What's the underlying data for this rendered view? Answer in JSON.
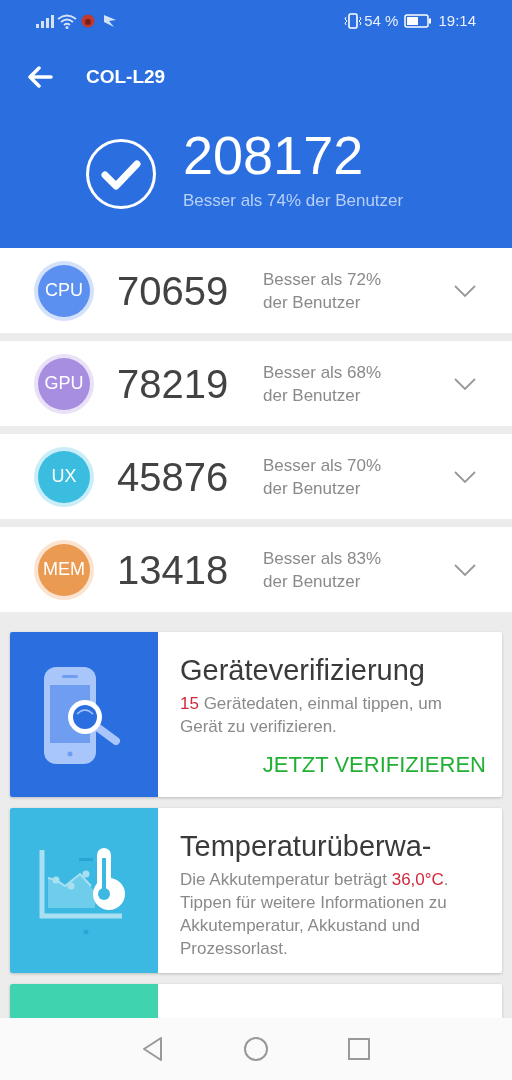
{
  "status_bar": {
    "battery_text": "54 %",
    "time": "19:14"
  },
  "header": {
    "title": "COL-L29",
    "total_score": "208172",
    "total_caption": "Besser als 74% der Benutzer"
  },
  "scores": [
    {
      "label": "CPU",
      "color": "#5b8ff0",
      "score": "70659",
      "caption": "Besser als 72% der Benutzer",
      "expanded": false
    },
    {
      "label": "GPU",
      "color": "#a88ee0",
      "score": "78219",
      "caption": "Besser als 68% der Benutzer",
      "expanded": false
    },
    {
      "label": "UX",
      "color": "#3bbde0",
      "score": "45876",
      "caption": "Besser als 70% der Benutzer",
      "expanded": false
    },
    {
      "label": "MEM",
      "color": "#eb9a52",
      "score": "13418",
      "caption": "Besser als 83% der Benutzer",
      "expanded": false
    }
  ],
  "cards": [
    {
      "kind": "verify",
      "color": "#2a6ee0",
      "title": "Geräteverifizierung",
      "description": [
        {
          "text": "15",
          "highlight": true
        },
        {
          "text": " Gerätedaten, einmal tippen, um Gerät zu verifizieren.",
          "highlight": false
        }
      ],
      "action": "JETZT VERIFIZIEREN"
    },
    {
      "kind": "temperature",
      "color": "#3cb9e2",
      "title": "Temperaturüberwa-",
      "description": [
        {
          "text": "Die Akkutemperatur beträgt ",
          "highlight": false
        },
        {
          "text": "36,0°C",
          "highlight": true
        },
        {
          "text": ". Tippen für weitere Informationen zu Akkutemperatur, Akkustand und Prozessorlast.",
          "highlight": false
        }
      ]
    },
    {
      "kind": "stress",
      "color": "#40d3b0"
    }
  ]
}
